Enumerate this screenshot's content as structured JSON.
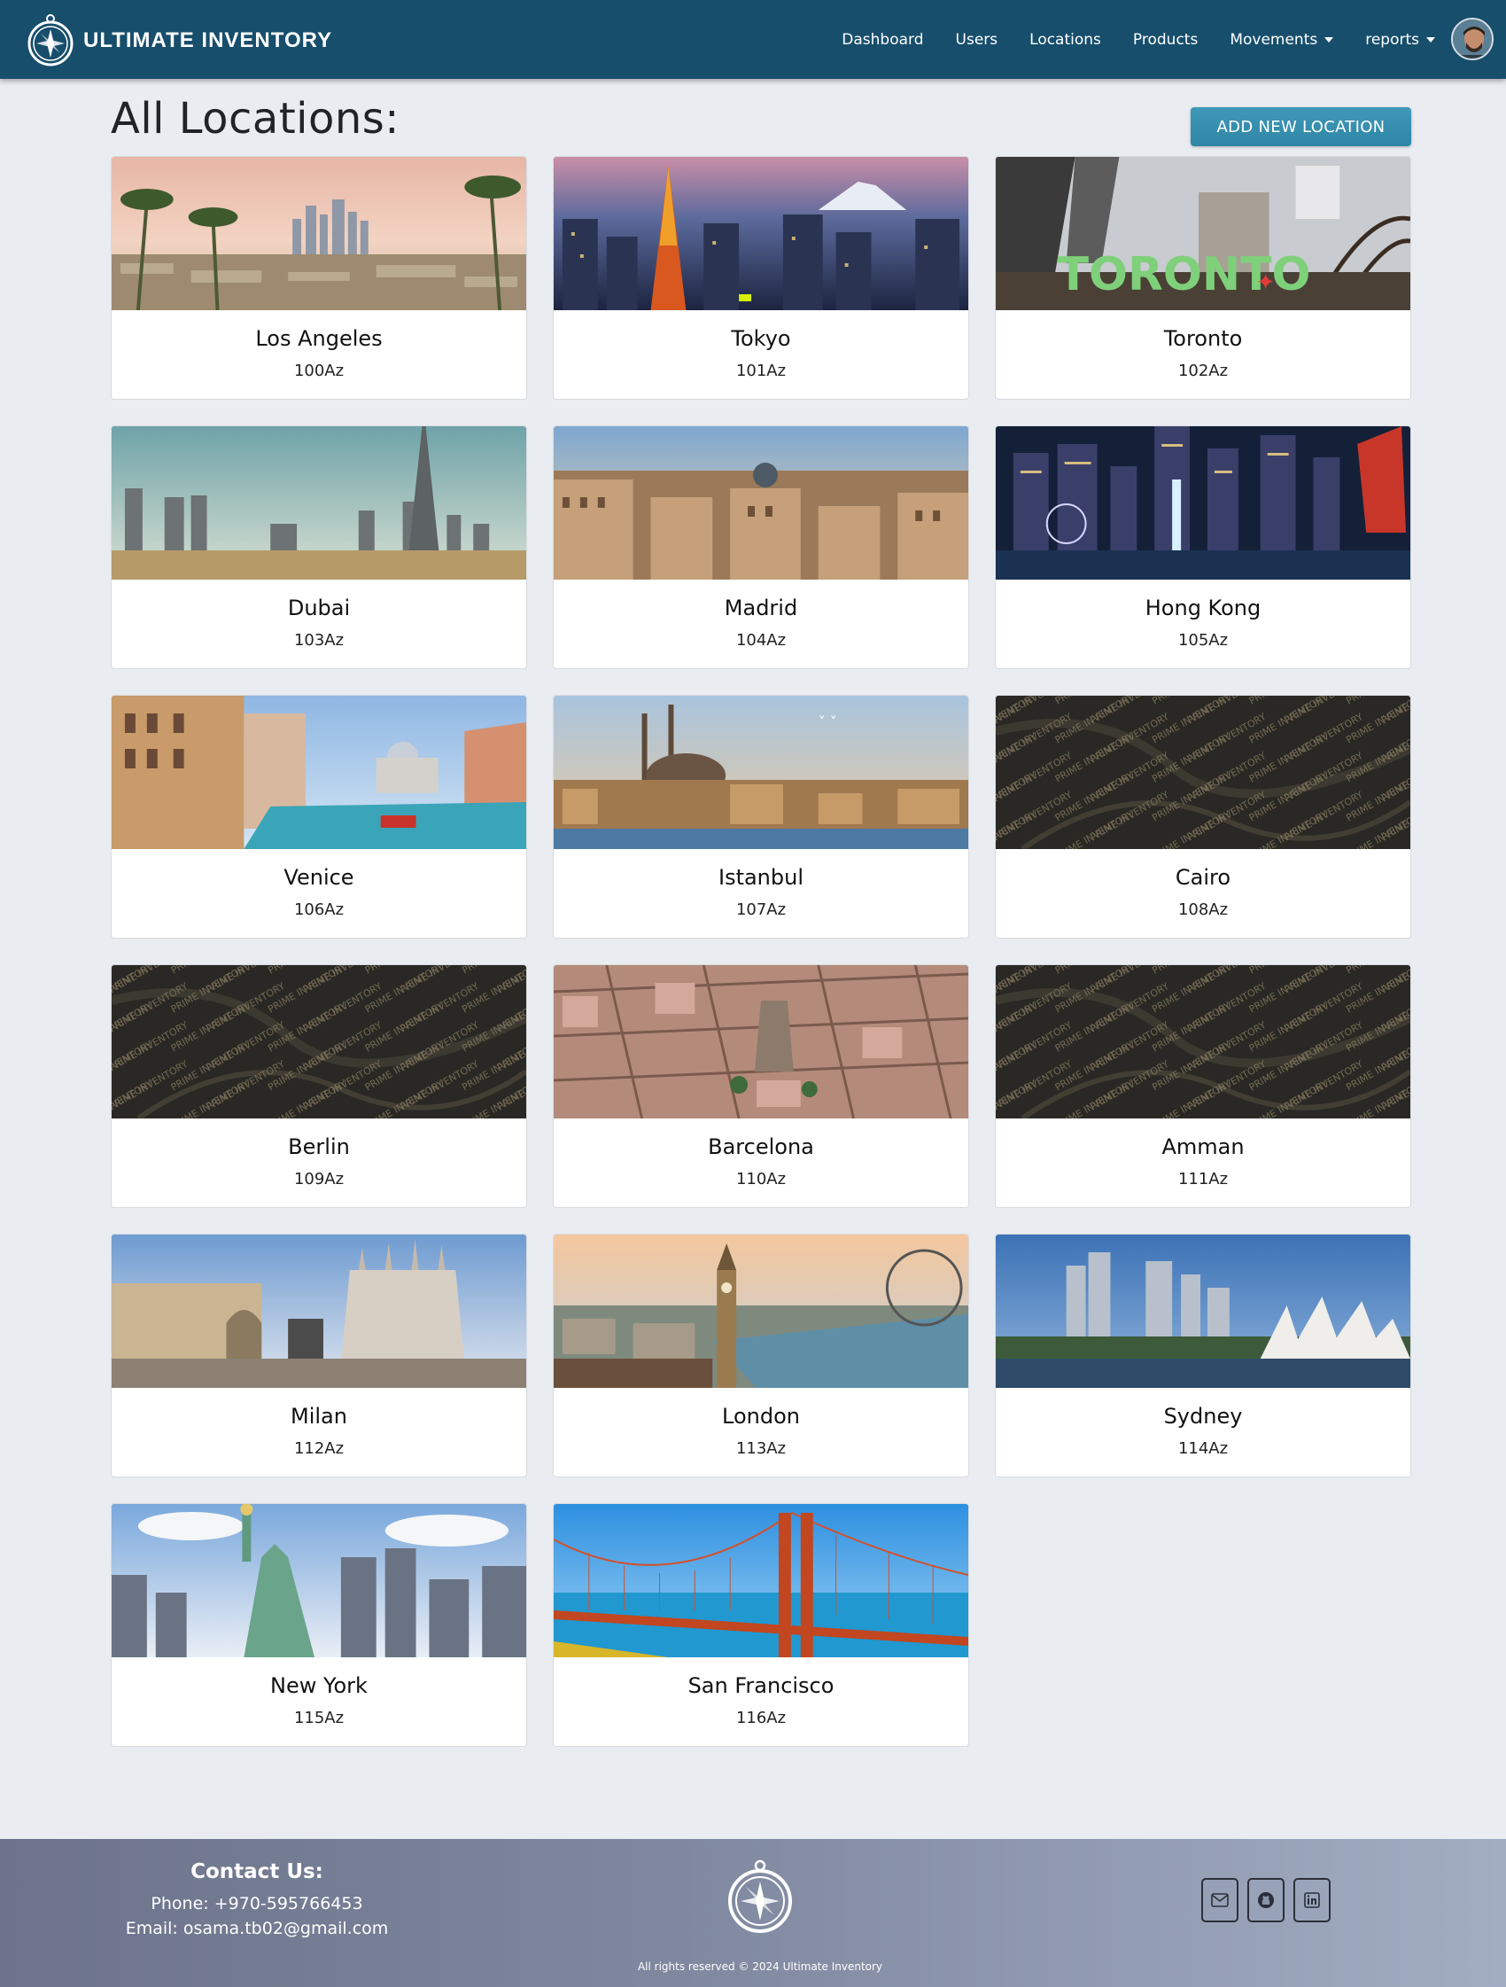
{
  "navbar": {
    "brand": "ULTIMATE INVENTORY",
    "links": [
      {
        "label": "Dashboard",
        "dropdown": false
      },
      {
        "label": "Users",
        "dropdown": false
      },
      {
        "label": "Locations",
        "dropdown": false
      },
      {
        "label": "Products",
        "dropdown": false
      },
      {
        "label": "Movements",
        "dropdown": true
      },
      {
        "label": "reports",
        "dropdown": true
      }
    ]
  },
  "page": {
    "title": "All Locations:",
    "add_button": "ADD NEW LOCATION"
  },
  "locations": [
    {
      "name": "Los Angeles",
      "code": "100Az",
      "image": "los-angeles-skyline"
    },
    {
      "name": "Tokyo",
      "code": "101Az",
      "image": "tokyo-tower-skyline"
    },
    {
      "name": "Toronto",
      "code": "102Az",
      "image": "toronto-sign"
    },
    {
      "name": "Dubai",
      "code": "103Az",
      "image": "dubai-skyline"
    },
    {
      "name": "Madrid",
      "code": "104Az",
      "image": "madrid-rooftops"
    },
    {
      "name": "Hong Kong",
      "code": "105Az",
      "image": "hong-kong-night-harbor"
    },
    {
      "name": "Venice",
      "code": "106Az",
      "image": "venice-canal"
    },
    {
      "name": "Istanbul",
      "code": "107Az",
      "image": "istanbul-mosques"
    },
    {
      "name": "Cairo",
      "code": "108Az",
      "image": "placeholder-pattern"
    },
    {
      "name": "Berlin",
      "code": "109Az",
      "image": "placeholder-pattern"
    },
    {
      "name": "Barcelona",
      "code": "110Az",
      "image": "barcelona-aerial"
    },
    {
      "name": "Amman",
      "code": "111Az",
      "image": "placeholder-pattern"
    },
    {
      "name": "Milan",
      "code": "112Az",
      "image": "milan-cathedral"
    },
    {
      "name": "London",
      "code": "113Az",
      "image": "london-big-ben"
    },
    {
      "name": "Sydney",
      "code": "114Az",
      "image": "sydney-opera-house"
    },
    {
      "name": "New York",
      "code": "115Az",
      "image": "statue-of-liberty"
    },
    {
      "name": "San Francisco",
      "code": "116Az",
      "image": "golden-gate-bridge"
    }
  ],
  "placeholder_watermark": "PRIME INVENTORY",
  "footer": {
    "contact_title": "Contact Us:",
    "phone": "Phone: +970-595766453",
    "email": "Email: osama.tb02@gmail.com",
    "copyright": "All rights reserved © 2024 Ultimate Inventory",
    "social_icons": [
      "mail-icon",
      "github-icon",
      "linkedin-icon"
    ]
  },
  "colors": {
    "navbar": "#174e6c",
    "button": "#3590b1",
    "background": "#e9ecf0"
  }
}
